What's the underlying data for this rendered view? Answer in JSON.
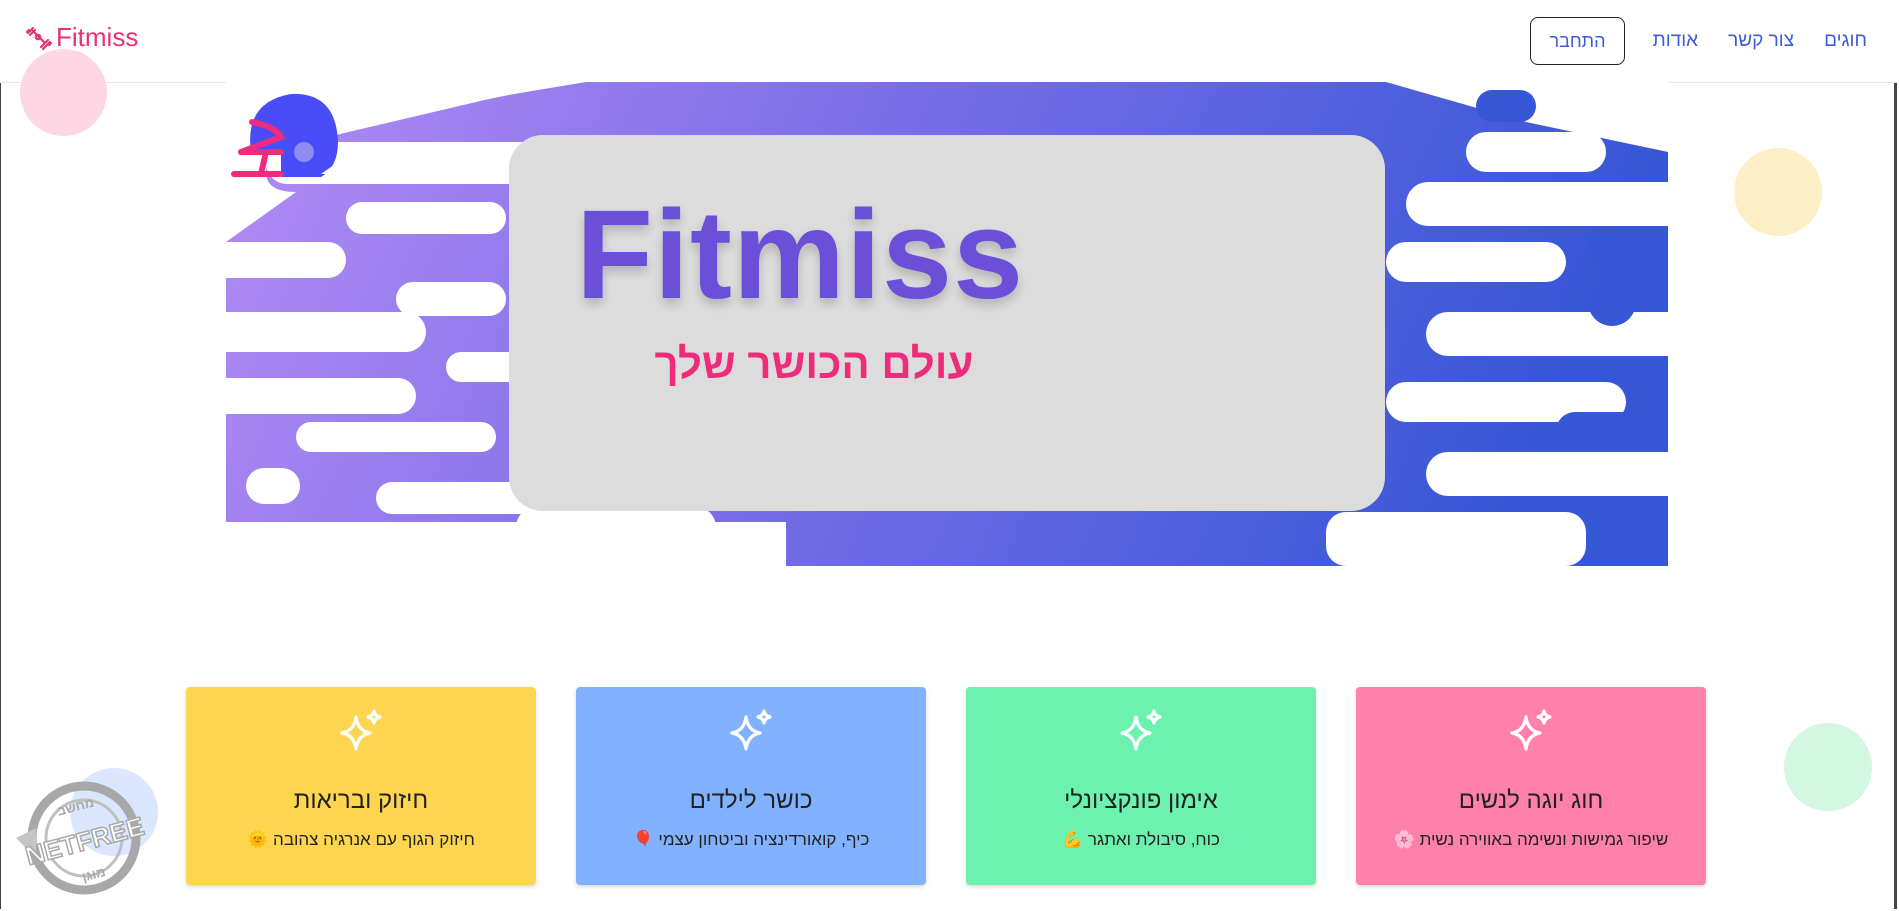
{
  "brand": {
    "name": "Fitmiss",
    "icon": "dumbbell-icon",
    "color": "#e8336e"
  },
  "nav": {
    "items": [
      "חוגים",
      "צור קשר",
      "אודות"
    ],
    "login_label": "התחבר",
    "link_color": "#3b5bdb"
  },
  "hero": {
    "title": "Fitmiss",
    "subtitle": "עולם הכושר שלך",
    "title_color": "#6c4fd8",
    "subtitle_color": "#ef2b7c",
    "icon": "football-helmet-icon"
  },
  "cards": [
    {
      "title": "חיזוק ובריאות",
      "desc": "חיזוק הגוף עם אנרגיה צהובה 🌞",
      "color": "#fdd551",
      "icon": "sparkles-icon"
    },
    {
      "title": "כושר לילדים",
      "desc": "כיף, קואורדינציה וביטחון עצמי 🎈",
      "color": "#82b1ff",
      "icon": "sparkles-icon"
    },
    {
      "title": "אימון פונקציונלי",
      "desc": "כוח, סיבולת ואתגר 💪",
      "color": "#6cf1af",
      "icon": "sparkles-icon"
    },
    {
      "title": "חוג יוגה לנשים",
      "desc": "שיפור גמישות ונשימה באווירה נשית 🌸",
      "color": "#ff80ab",
      "icon": "sparkles-icon"
    }
  ],
  "watermark": {
    "icon": "netfree-stamp-icon",
    "text": [
      "מחשב",
      "NETFREE",
      "מוגן"
    ]
  }
}
